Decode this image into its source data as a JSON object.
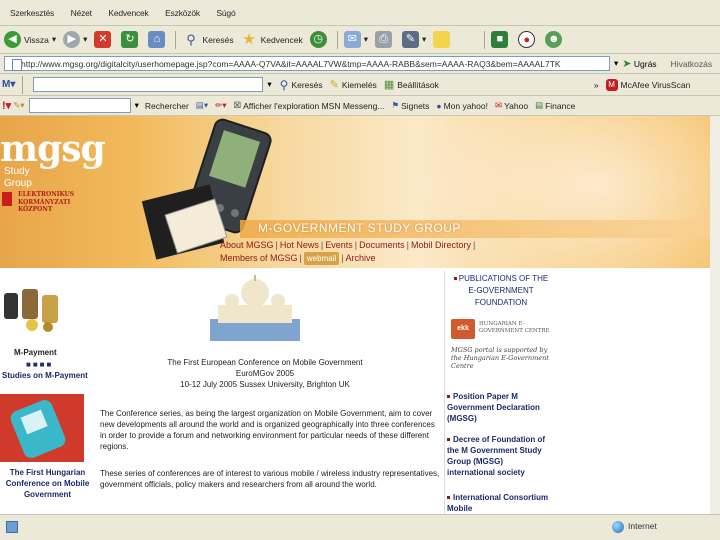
{
  "menubar": {
    "items": [
      "Szerkesztés",
      "Nézet",
      "Kedvencek",
      "Eszközök",
      "Súgó"
    ]
  },
  "navbar": {
    "back_label": "Vissza",
    "search_label": "Keresés",
    "favorites_label": "Kedvencek"
  },
  "address": {
    "url": "http://www.mgsg.org/digitalcity/userhomepage.jsp?com=AAAA-Q7VA&it=AAAAL7VW&tmp=AAAA-RABB&sem=AAAA-RAQ3&bem=AAAAL7TK",
    "go_label": "Ugrás",
    "links_label": "Hivatkozás"
  },
  "msnbar": {
    "search_label": "Keresés",
    "highlight_label": "Kiemelés",
    "options_label": "Beállítások",
    "mcafee_label": "McAfee VirusScan"
  },
  "searchbar": {
    "search_label": "Rechercher",
    "item1": "Afficher l'exploration MSN Messeng...",
    "item2": "Signets",
    "item3": "Mon yahoo!",
    "item4": "Yahoo",
    "item5": "Finance"
  },
  "banner": {
    "logo": "mgsg",
    "subtitle_line1": "Study",
    "subtitle_line2": "Group",
    "partner_line1": "ELEKTRONIKUS",
    "partner_line2": "KORMÁNYZATI",
    "partner_line3": "KÖZPONT",
    "heading": "M-GOVERNMENT STUDY GROUP"
  },
  "nav_links": {
    "about": "About MGSG",
    "hot_news": "Hot News",
    "events": "Events",
    "documents": "Documents",
    "mobil_directory": "Mobil Directory",
    "members": "Members of MGSG",
    "webmail": "webmail",
    "archive": "Archive"
  },
  "left_column": {
    "payment_label": "M-Payment",
    "payment_bullets": "■■■■",
    "studies_label": "Studies on M-Payment",
    "first_hungarian_line1": "The First Hungarian",
    "first_hungarian_line2": "Conference on Mobile",
    "first_hungarian_line3": "Government"
  },
  "conference": {
    "line1": "The First European Conference on Mobile Government",
    "line2": "EuroMGov 2005",
    "line3": "10-12 July 2005 Sussex University, Brighton UK"
  },
  "body_text": {
    "para1": "The Conference series, as being the largest organization on Mobile Government, aim to cover new developments all around the world and is organized geographically into three conferences in order to provide a forum and networking environment for particular needs of these different regions.",
    "para2": "These series of conferences are of interest to various mobile / wireless industry representatives, government officials, policy makers and researchers from all around the world."
  },
  "right_column": {
    "publications_title": "PUBLICATIONS OF THE E-GOVERNMENT FOUNDATION",
    "egov_logo": "ekk",
    "egov_name": "HUNGARIAN E-GOVERNMENT CENTRE",
    "egov_note": "MGSG portal is supported by the Hungarian E-Government Centre",
    "item1": "Position Paper M Government Declaration (MGSG)",
    "item2": "Decree of Foundation of the M Government Study Group (MGSG) international society",
    "item3": "International Consortium Mobile"
  },
  "statusbar": {
    "zone": "Internet"
  },
  "colors": {
    "chrome": "#ece9d8",
    "banner_orange": "#f2b95a",
    "link_red": "#8a1a1a",
    "heading_navy": "#1a2a6e"
  }
}
